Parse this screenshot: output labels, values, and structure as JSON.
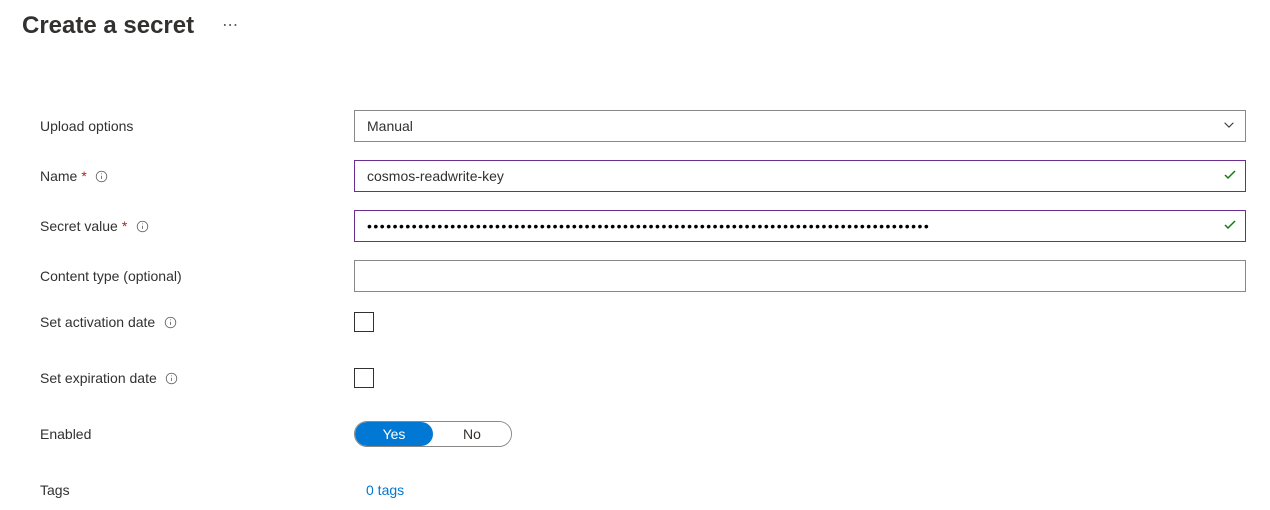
{
  "header": {
    "title": "Create a secret"
  },
  "form": {
    "upload_options": {
      "label": "Upload options",
      "value": "Manual"
    },
    "name": {
      "label": "Name",
      "value": "cosmos-readwrite-key"
    },
    "secret_value": {
      "label": "Secret value",
      "masked_value": "••••••••••••••••••••••••••••••••••••••••••••••••••••••••••••••••••••••••••••••••••••••••"
    },
    "content_type": {
      "label": "Content type (optional)",
      "value": ""
    },
    "activation": {
      "label": "Set activation date"
    },
    "expiration": {
      "label": "Set expiration date"
    },
    "enabled": {
      "label": "Enabled",
      "yes": "Yes",
      "no": "No"
    },
    "tags": {
      "label": "Tags",
      "link": "0 tags"
    }
  }
}
